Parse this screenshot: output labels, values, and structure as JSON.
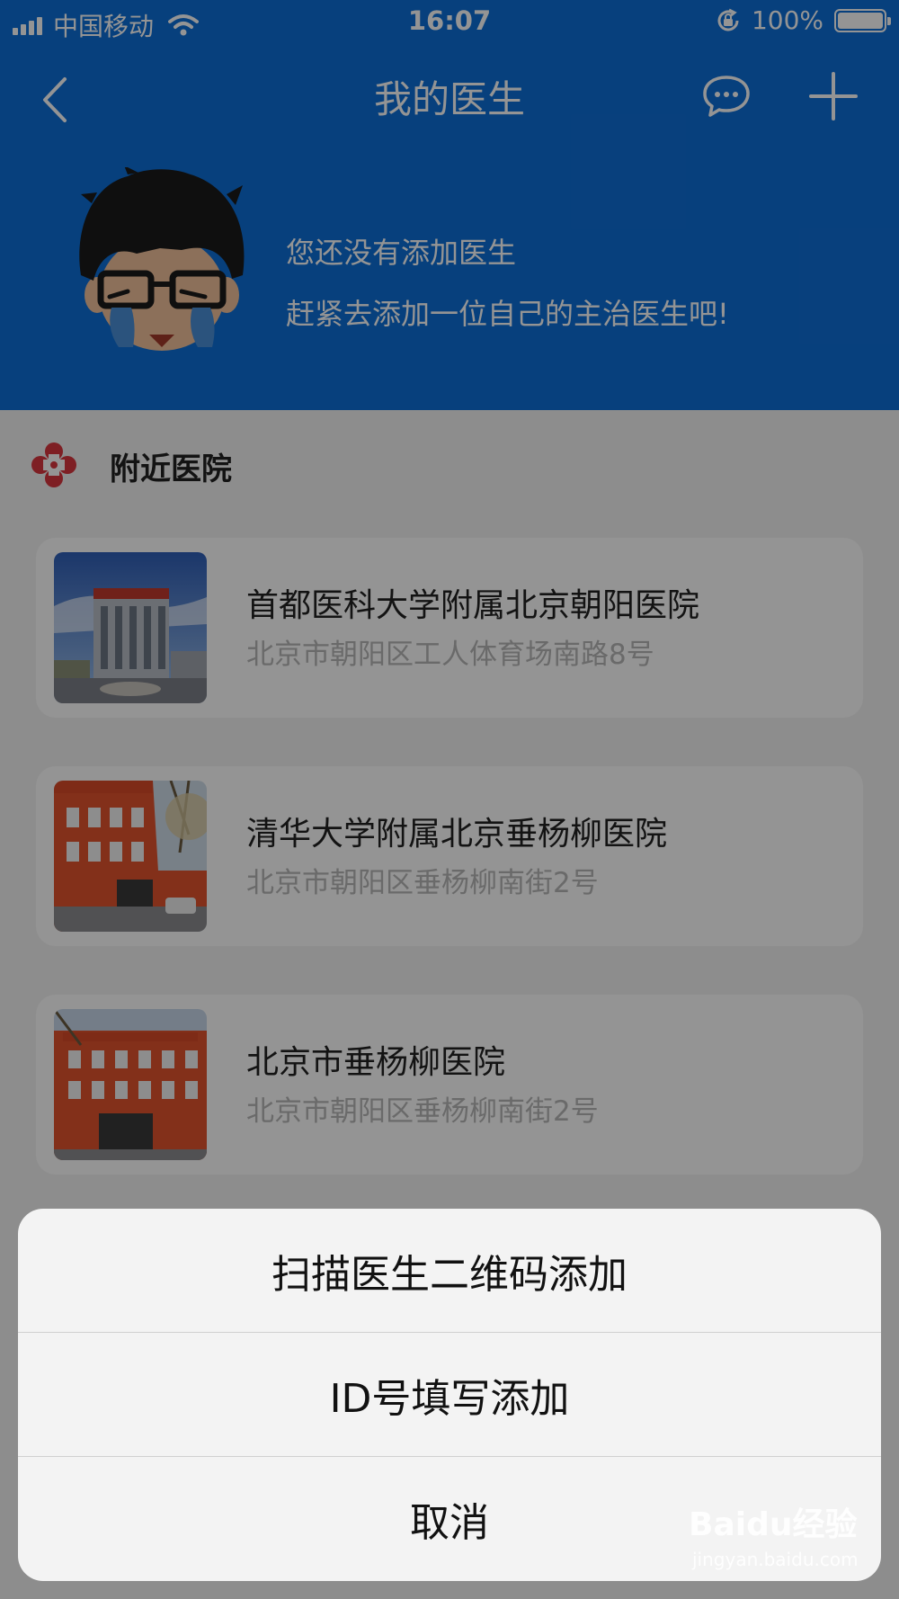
{
  "status_bar": {
    "carrier": "中国移动",
    "time": "16:07",
    "battery": "100%",
    "icons": [
      "signal-icon",
      "wifi-icon",
      "rotation-lock-icon",
      "battery-icon"
    ]
  },
  "nav": {
    "title": "我的医生",
    "icons": [
      "back-chevron-icon",
      "chat-bubble-icon",
      "plus-icon"
    ]
  },
  "empty_state": {
    "line1": "您还没有添加医生",
    "line2": "赶紧去添加一位自己的主治医生吧!"
  },
  "section": {
    "title": "附近医院",
    "icon": "hospital-cross-icon"
  },
  "hospitals": [
    {
      "name": "首都医科大学附属北京朝阳医院",
      "address": "北京市朝阳区工人体育场南路8号"
    },
    {
      "name": "清华大学附属北京垂杨柳医院",
      "address": "北京市朝阳区垂杨柳南街2号"
    },
    {
      "name": "北京市垂杨柳医院",
      "address": "北京市朝阳区垂杨柳南街2号"
    }
  ],
  "action_sheet": {
    "scan_label": "扫描医生二维码添加",
    "id_label": "ID号填写添加",
    "cancel_label": "取消"
  },
  "watermark": {
    "main": "Baidu经验",
    "sub": "jingyan.baidu.com"
  },
  "colors": {
    "header_blue": "#0d6fd8",
    "hospital_red": "#d9363e",
    "address_gray": "#b7b7b7"
  }
}
